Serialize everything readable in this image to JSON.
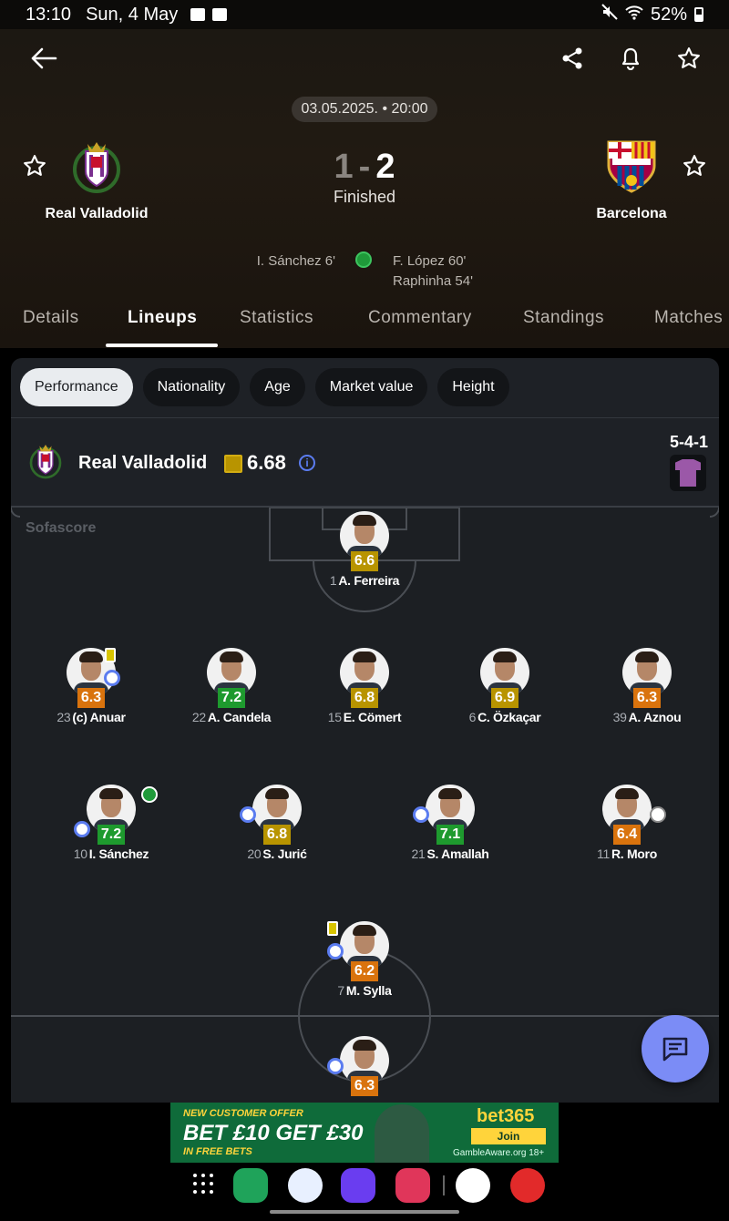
{
  "status_bar": {
    "time": "13:10",
    "date": "Sun, 4 May",
    "battery": "52%"
  },
  "match": {
    "date_time": "03.05.2025. • 20:00",
    "home_team": "Real Valladolid",
    "away_team": "Barcelona",
    "home_score": "1",
    "separator": "-",
    "away_score": "2",
    "status": "Finished",
    "home_scorers": [
      "I. Sánchez 6'"
    ],
    "away_scorers": [
      "F. López 60'",
      "Raphinha 54'"
    ]
  },
  "tabs": [
    "Details",
    "Lineups",
    "Statistics",
    "Commentary",
    "Standings",
    "Matches"
  ],
  "active_tab": "Lineups",
  "filters": [
    "Performance",
    "Nationality",
    "Age",
    "Market value",
    "Height"
  ],
  "active_filter": "Performance",
  "lineup_team": {
    "name": "Real Valladolid",
    "avg_rating": "6.68",
    "formation": "5-4-1",
    "info_icon": "i"
  },
  "watermark": "Sofascore",
  "players": [
    {
      "num": "1",
      "name": "A. Ferreira",
      "rating": "6.6",
      "rating_color": "#b89400",
      "badges": []
    },
    {
      "num": "23",
      "name": "(c) Anuar",
      "rating": "6.3",
      "rating_color": "#d9730d",
      "badges": [
        "card",
        "sub"
      ]
    },
    {
      "num": "22",
      "name": "A. Candela",
      "rating": "7.2",
      "rating_color": "#1e9a2e",
      "badges": []
    },
    {
      "num": "15",
      "name": "E. Cömert",
      "rating": "6.8",
      "rating_color": "#b89400",
      "badges": []
    },
    {
      "num": "6",
      "name": "C. Özkaçar",
      "rating": "6.9",
      "rating_color": "#b89400",
      "badges": []
    },
    {
      "num": "39",
      "name": "A. Aznou",
      "rating": "6.3",
      "rating_color": "#d9730d",
      "badges": []
    },
    {
      "num": "10",
      "name": "I. Sánchez",
      "rating": "7.2",
      "rating_color": "#1e9a2e",
      "badges": [
        "sub",
        "goal"
      ]
    },
    {
      "num": "20",
      "name": "S. Jurić",
      "rating": "6.8",
      "rating_color": "#b89400",
      "badges": [
        "sub"
      ]
    },
    {
      "num": "21",
      "name": "S. Amallah",
      "rating": "7.1",
      "rating_color": "#1e9a2e",
      "badges": [
        "sub"
      ]
    },
    {
      "num": "11",
      "name": "R. Moro",
      "rating": "6.4",
      "rating_color": "#d9730d",
      "badges": [
        "miss"
      ]
    },
    {
      "num": "7",
      "name": "M. Sylla",
      "rating": "6.2",
      "rating_color": "#d9730d",
      "badges": [
        "card",
        "sub"
      ]
    },
    {
      "num": "",
      "name": "",
      "rating": "6.3",
      "rating_color": "#d9730d",
      "badges": [
        "sub"
      ]
    }
  ],
  "ad": {
    "line1": "NEW CUSTOMER OFFER",
    "line2": "BET £10 GET £30",
    "line3": "IN FREE BETS",
    "brand": "bet365",
    "cta": "Join",
    "disclaimer": "GambleAware.org 18+"
  },
  "colors": {
    "accent": "#7b8cf6",
    "rating_avg": "#b89400"
  },
  "icons": [
    "back-arrow-icon",
    "share-icon",
    "bell-icon",
    "star-icon",
    "chat-icon",
    "apps-grid-icon"
  ]
}
